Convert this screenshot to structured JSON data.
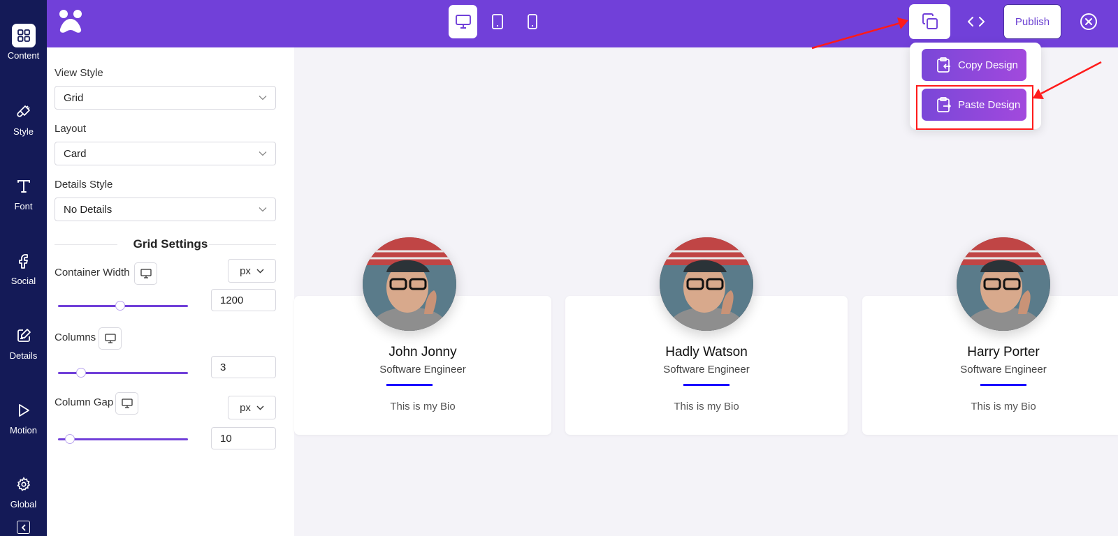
{
  "rail": {
    "items": [
      {
        "label": "Content",
        "icon": "grid-icon"
      },
      {
        "label": "Style",
        "icon": "brush-icon"
      },
      {
        "label": "Font",
        "icon": "text-icon"
      },
      {
        "label": "Social",
        "icon": "facebook-icon"
      },
      {
        "label": "Details",
        "icon": "edit-icon"
      },
      {
        "label": "Motion",
        "icon": "play-icon"
      },
      {
        "label": "Global",
        "icon": "gear-icon"
      }
    ]
  },
  "topbar": {
    "devices": [
      "desktop",
      "tablet",
      "mobile"
    ],
    "active_device": "desktop",
    "publish_label": "Publish"
  },
  "panel": {
    "view_style": {
      "label": "View Style",
      "value": "Grid"
    },
    "layout": {
      "label": "Layout",
      "value": "Card"
    },
    "details_style": {
      "label": "Details Style",
      "value": "No Details"
    },
    "grid_settings_title": "Grid Settings",
    "container_width": {
      "label": "Container Width",
      "unit": "px",
      "value": "1200",
      "slider_fraction": 0.48
    },
    "columns": {
      "label": "Columns",
      "value": "3",
      "slider_fraction": 0.18
    },
    "column_gap": {
      "label": "Column Gap",
      "unit": "px",
      "value": "10",
      "slider_fraction": 0.09
    }
  },
  "dropdown": {
    "copy_label": "Copy Design",
    "paste_label": "Paste Design"
  },
  "cards": [
    {
      "name": "John Jonny",
      "role": "Software Engineer",
      "bio": "This is my Bio"
    },
    {
      "name": "Hadly Watson",
      "role": "Software Engineer",
      "bio": "This is my Bio"
    },
    {
      "name": "Harry Porter",
      "role": "Software Engineer",
      "bio": "This is my Bio"
    }
  ],
  "colors": {
    "rail": "#141a57",
    "topbar": "#7140d9",
    "accent_gradient": [
      "#7a47d8",
      "#a249dd"
    ],
    "divider": "#1a00ff",
    "annotation": "#ff1b1b"
  }
}
